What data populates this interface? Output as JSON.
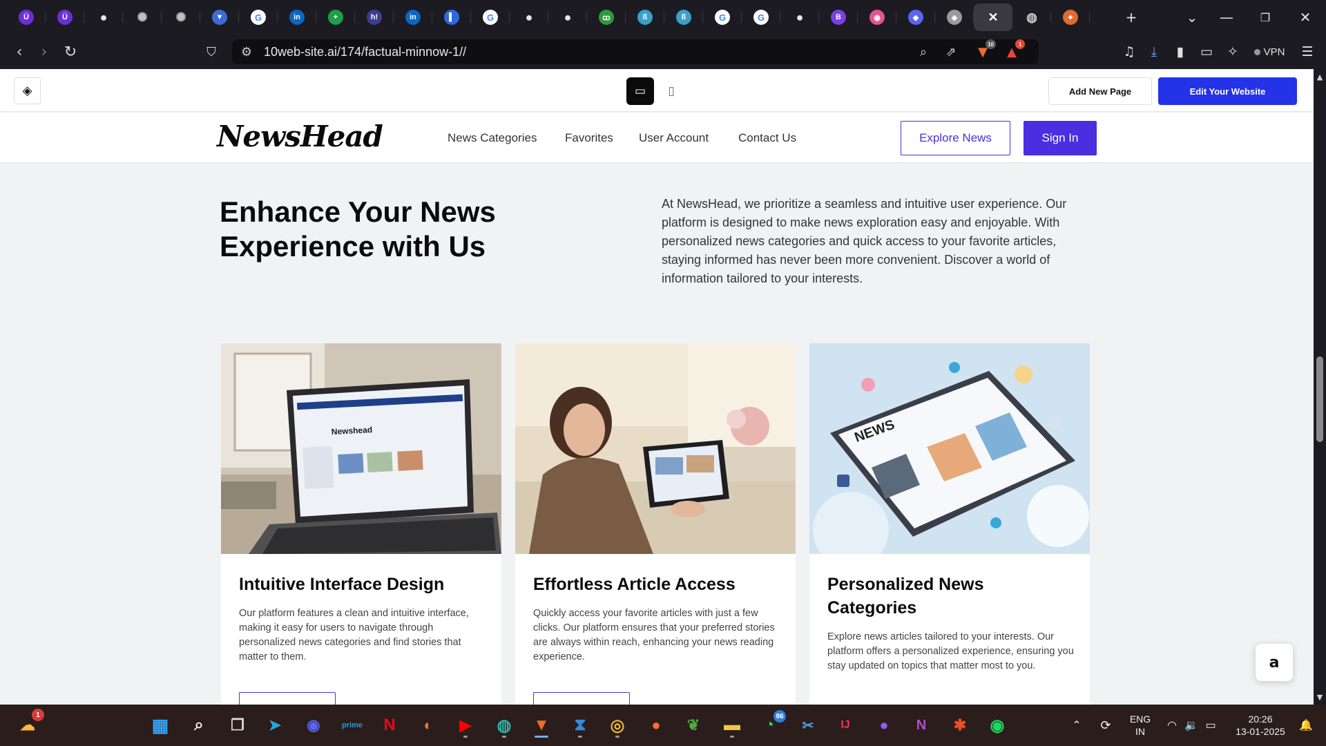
{
  "browser": {
    "tabs": [
      {
        "icon": "u-shield-icon",
        "glyph": "Ü",
        "color": "#6b2fd6"
      },
      {
        "icon": "u-shield-icon",
        "glyph": "Ü",
        "color": "#6b2fd6"
      },
      {
        "icon": "github-icon",
        "glyph": "●",
        "color": "#e6e6e6"
      },
      {
        "icon": "openai-icon",
        "glyph": "✺",
        "color": "#bfbfbf"
      },
      {
        "icon": "openai-icon",
        "glyph": "✺",
        "color": "#bfbfbf"
      },
      {
        "icon": "bitwarden-icon",
        "glyph": "▼",
        "color": "#3c6bd6"
      },
      {
        "icon": "google-icon",
        "glyph": "G",
        "color": "#ffffff"
      },
      {
        "icon": "linkedin-icon",
        "glyph": "in",
        "color": "#0a66c2"
      },
      {
        "icon": "sheets-icon",
        "glyph": "+",
        "color": "#1e9e4a"
      },
      {
        "icon": "hashnode-icon",
        "glyph": "h!",
        "color": "#3b3f8f"
      },
      {
        "icon": "linkedin-icon",
        "glyph": "in",
        "color": "#0a66c2"
      },
      {
        "icon": "sidebar-doc-icon",
        "glyph": "▌",
        "color": "#2a6ae0"
      },
      {
        "icon": "google-icon",
        "glyph": "G",
        "color": "#ffffff"
      },
      {
        "icon": "github-icon",
        "glyph": "●",
        "color": "#e6e6e6"
      },
      {
        "icon": "github-icon",
        "glyph": "●",
        "color": "#e6e6e6"
      },
      {
        "icon": "glitch-icon",
        "glyph": "ꝏ",
        "color": "#2e9a3e"
      },
      {
        "icon": "bolt-icon",
        "glyph": "ß",
        "color": "#3aa0c8"
      },
      {
        "icon": "bolt-icon",
        "glyph": "ß",
        "color": "#3aa0c8"
      },
      {
        "icon": "google-icon",
        "glyph": "G",
        "color": "#ffffff"
      },
      {
        "icon": "google-icon",
        "glyph": "G",
        "color": "#ffffff"
      },
      {
        "icon": "github-icon",
        "glyph": "●",
        "color": "#e6e6e6"
      },
      {
        "icon": "bootstrap-icon",
        "glyph": "B",
        "color": "#7b3fe4"
      },
      {
        "icon": "dribbble-icon",
        "glyph": "◉",
        "color": "#e2558f"
      },
      {
        "icon": "discord-blue-icon",
        "glyph": "◆",
        "color": "#5865f2"
      },
      {
        "icon": "tenweb-icon",
        "glyph": "◈",
        "color": "#9a9a9a"
      },
      {
        "icon": "close-tab-icon",
        "glyph": "✕",
        "color": "#ffffff",
        "active": true
      },
      {
        "icon": "globe-icon",
        "glyph": "◍",
        "color": "#cfcfcf"
      },
      {
        "icon": "colorful-app-icon",
        "glyph": "✦",
        "color": "#e06b2f"
      }
    ],
    "new_tab": "+",
    "url": "10web-site.ai/174/factual-minnow-1//",
    "brave_badge": "10",
    "alert_badge": "1",
    "vpn_label": "VPN"
  },
  "editor": {
    "add_page": "Add New Page",
    "edit_site": "Edit Your Website"
  },
  "site": {
    "brand": "NewsHead",
    "nav": [
      "News Categories",
      "Favorites",
      "User Account",
      "Contact Us"
    ],
    "explore": "Explore News",
    "signin": "Sign In",
    "hero_title": "Enhance Your News Experience with Us",
    "hero_body": "At NewsHead, we prioritize a seamless and intuitive user experience. Our platform is designed to make news exploration easy and enjoyable. With personalized news categories and quick access to your favorite articles, staying informed has never been more convenient. Discover a world of information tailored to your interests.",
    "cards": [
      {
        "title": "Intuitive Interface Design",
        "body": "Our platform features a clean and intuitive interface, making it easy for users to navigate through personalized news categories and find stories that matter to them.",
        "image": "laptop-photo",
        "screen_title": "Newshead"
      },
      {
        "title": "Effortless Article Access",
        "body": "Quickly access your favorite articles with just a few clicks. Our platform ensures that your preferred stories are always within reach, enhancing your news reading experience.",
        "image": "woman-tablet-photo"
      },
      {
        "title": "Personalized News Categories",
        "body": "Explore news articles tailored to your interests. Our platform offers a personalized experience, ensuring you stay updated on topics that matter most to you.",
        "image": "tablet-illustration",
        "tablet_title": "NEWS"
      }
    ]
  },
  "taskbar": {
    "weather_badge": "1",
    "whatsapp_badge": "86",
    "lang_1": "ENG",
    "lang_2": "IN",
    "time": "20:26",
    "date": "13-01-2025"
  }
}
